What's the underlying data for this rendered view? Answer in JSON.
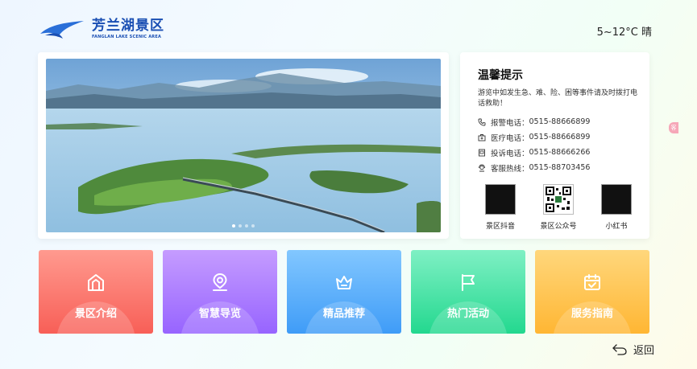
{
  "header": {
    "logo_cn": "芳兰湖景区",
    "logo_en": "FANGLAN LAKE SCENIC AREA",
    "weather": "5~12°C 晴"
  },
  "banner": {
    "slide_count": 4,
    "active_slide": 1
  },
  "tips": {
    "title": "温馨提示",
    "description": "游览中如发生急、难、险、困等事件请及时拨打电话救助！",
    "contacts": [
      {
        "icon": "phone-icon",
        "label": "报警电话：",
        "value": "0515-88666899"
      },
      {
        "icon": "medical-icon",
        "label": "医疗电话：",
        "value": "0515-88666899"
      },
      {
        "icon": "complaint-icon",
        "label": "投诉电话：",
        "value": "0515-88666266"
      },
      {
        "icon": "headset-icon",
        "label": "客服热线：",
        "value": "0515-88703456"
      }
    ],
    "qr_codes": [
      {
        "label": "景区抖音"
      },
      {
        "label": "景区公众号"
      },
      {
        "label": "小红书"
      }
    ]
  },
  "side_tab": {
    "label": "客"
  },
  "tiles": [
    {
      "label": "景区介绍",
      "icon": "building-icon",
      "color": "#f85f57"
    },
    {
      "label": "智慧导览",
      "icon": "location-pin-icon",
      "color": "#9764ff"
    },
    {
      "label": "精品推荐",
      "icon": "crown-icon",
      "color": "#3f9cf7"
    },
    {
      "label": "热门活动",
      "icon": "flag-icon",
      "color": "#23d88f"
    },
    {
      "label": "服务指南",
      "icon": "calendar-check-icon",
      "color": "#ffb633"
    }
  ],
  "back": {
    "label": "返回",
    "icon": "back-arrow-icon"
  }
}
